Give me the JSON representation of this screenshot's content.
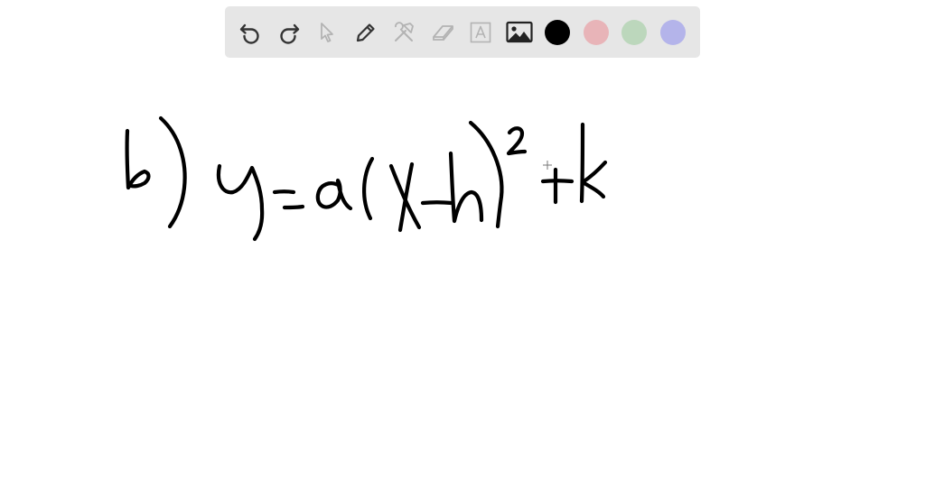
{
  "toolbar": {
    "tools": [
      {
        "name": "undo",
        "icon": "undo-icon",
        "enabled": true
      },
      {
        "name": "redo",
        "icon": "redo-icon",
        "enabled": true
      },
      {
        "name": "select",
        "icon": "cursor-icon",
        "enabled": false
      },
      {
        "name": "pen",
        "icon": "pencil-icon",
        "enabled": true
      },
      {
        "name": "tools",
        "icon": "tools-icon",
        "enabled": false
      },
      {
        "name": "eraser",
        "icon": "eraser-icon",
        "enabled": false
      },
      {
        "name": "text",
        "icon": "text-box-icon",
        "enabled": false
      },
      {
        "name": "image",
        "icon": "image-icon",
        "enabled": true
      }
    ],
    "colors": [
      {
        "name": "black",
        "hex": "#000000",
        "selected": true
      },
      {
        "name": "pink",
        "hex": "#e8b4b8",
        "selected": false
      },
      {
        "name": "green",
        "hex": "#bcd7bc",
        "selected": false
      },
      {
        "name": "purple",
        "hex": "#b4b4ea",
        "selected": false
      }
    ]
  },
  "canvas": {
    "handwriting": "b) y=a(x-h)^2+k",
    "ink_color": "#000000"
  },
  "colors": {
    "toolbar_bg": "#e6e6e6",
    "icon_active": "#333333",
    "icon_disabled": "#b3b3b3"
  }
}
